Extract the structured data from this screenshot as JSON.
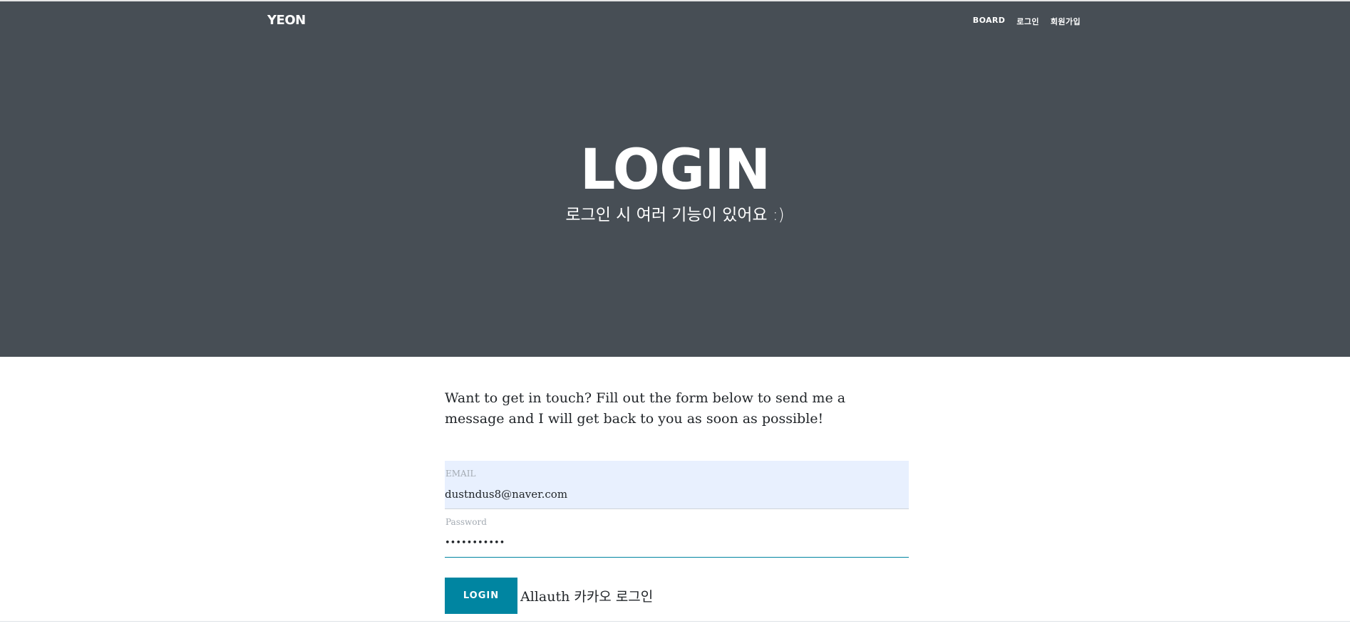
{
  "brand": "YEON",
  "nav": {
    "items": [
      "BOARD",
      "로그인",
      "회원가입"
    ]
  },
  "hero": {
    "title": "LOGIN",
    "subtitle": "로그인 시 여러 기능이 있어요 :)"
  },
  "intro": "Want to get in touch? Fill out the form below to send me a message and I will get back to you as soon as possible!",
  "form": {
    "email": {
      "label": "EMAIL",
      "value": "dustndus8@naver.com"
    },
    "password": {
      "label": "Password",
      "value": "•••••••••••"
    },
    "login_label": "LOGIN",
    "social_label": "Allauth 카카오 로그인"
  },
  "colors": {
    "hero_bg": "#474e55",
    "accent": "#0085a1",
    "autofill_bg": "#e8f0fe"
  }
}
